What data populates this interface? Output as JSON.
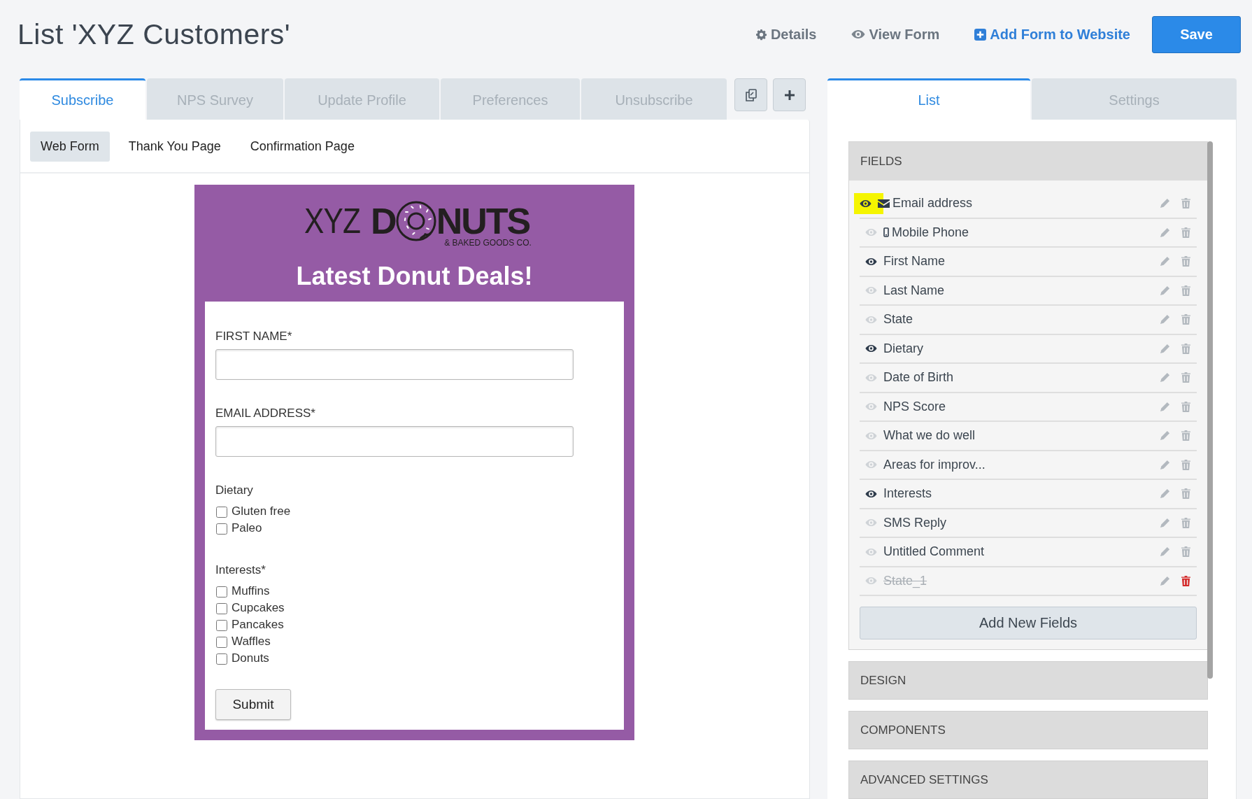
{
  "page": {
    "title": "List 'XYZ Customers'"
  },
  "header_actions": [
    {
      "kind": "gear",
      "label": "Details"
    },
    {
      "kind": "eye",
      "label": "View Form"
    },
    {
      "kind": "plus",
      "label": "Add Form to Website"
    },
    {
      "kind": "primary",
      "label": "Save"
    }
  ],
  "form_tabs": [
    {
      "label": "Subscribe",
      "selected": true
    },
    {
      "label": "NPS Survey",
      "selected": false
    },
    {
      "label": "Update Profile",
      "selected": false
    },
    {
      "label": "Preferences",
      "selected": false
    },
    {
      "label": "Unsubscribe",
      "selected": false
    }
  ],
  "tab_tools": [
    {
      "kind": "copy"
    },
    {
      "kind": "add"
    }
  ],
  "sub_tabs": [
    {
      "label": "Web Form",
      "selected": true
    },
    {
      "label": "Thank You Page",
      "selected": false
    },
    {
      "label": "Confirmation Page",
      "selected": false
    }
  ],
  "form_preview": {
    "logo": {
      "prefix": "XYZ",
      "word_start": "D",
      "word_end": "NUTS",
      "tagline": "& BAKED GOODS CO."
    },
    "heading": "Latest Donut Deals!",
    "fields": [
      {
        "kind": "text",
        "label": "FIRST NAME*"
      },
      {
        "kind": "text",
        "label": "EMAIL ADDRESS*"
      },
      {
        "kind": "checkboxes",
        "label": "Dietary",
        "options": [
          {
            "label": "Gluten free",
            "checked": false
          },
          {
            "label": "Paleo",
            "checked": false
          }
        ]
      },
      {
        "kind": "checkboxes",
        "label": "Interests*",
        "options": [
          {
            "label": "Muffins",
            "checked": false
          },
          {
            "label": "Cupcakes",
            "checked": false
          },
          {
            "label": "Pancakes",
            "checked": false
          },
          {
            "label": "Waffles",
            "checked": false
          },
          {
            "label": "Donuts",
            "checked": false
          }
        ]
      }
    ],
    "submit": "Submit"
  },
  "side_tabs": [
    {
      "label": "List",
      "selected": true
    },
    {
      "label": "Settings",
      "selected": false
    }
  ],
  "fields_section": {
    "title": "FIELDS",
    "items": [
      {
        "kind": "email",
        "name": "Email address",
        "visible": true,
        "highlighted": true,
        "deleted": false
      },
      {
        "kind": "phone",
        "name": "Mobile Phone",
        "visible": false,
        "highlighted": false,
        "deleted": false
      },
      {
        "kind": "plain",
        "name": "First Name",
        "visible": true,
        "highlighted": false,
        "deleted": false
      },
      {
        "kind": "plain",
        "name": "Last Name",
        "visible": false,
        "highlighted": false,
        "deleted": false
      },
      {
        "kind": "plain",
        "name": "State",
        "visible": false,
        "highlighted": false,
        "deleted": false
      },
      {
        "kind": "plain",
        "name": "Dietary",
        "visible": true,
        "highlighted": false,
        "deleted": false
      },
      {
        "kind": "plain",
        "name": "Date of Birth",
        "visible": false,
        "highlighted": false,
        "deleted": false
      },
      {
        "kind": "plain",
        "name": "NPS Score",
        "visible": false,
        "highlighted": false,
        "deleted": false
      },
      {
        "kind": "plain",
        "name": "What we do well",
        "visible": false,
        "highlighted": false,
        "deleted": false
      },
      {
        "kind": "plain",
        "name": "Areas for improv...",
        "visible": false,
        "highlighted": false,
        "deleted": false
      },
      {
        "kind": "plain",
        "name": "Interests",
        "visible": true,
        "highlighted": false,
        "deleted": false
      },
      {
        "kind": "plain",
        "name": "SMS Reply",
        "visible": false,
        "highlighted": false,
        "deleted": false
      },
      {
        "kind": "plain",
        "name": "Untitled Comment",
        "visible": false,
        "highlighted": false,
        "deleted": false
      },
      {
        "kind": "plain",
        "name": "State_1",
        "visible": false,
        "highlighted": false,
        "deleted": true
      }
    ],
    "add_button": "Add New Fields"
  },
  "other_sections": [
    "DESIGN",
    "COMPONENTS",
    "ADVANCED SETTINGS"
  ]
}
